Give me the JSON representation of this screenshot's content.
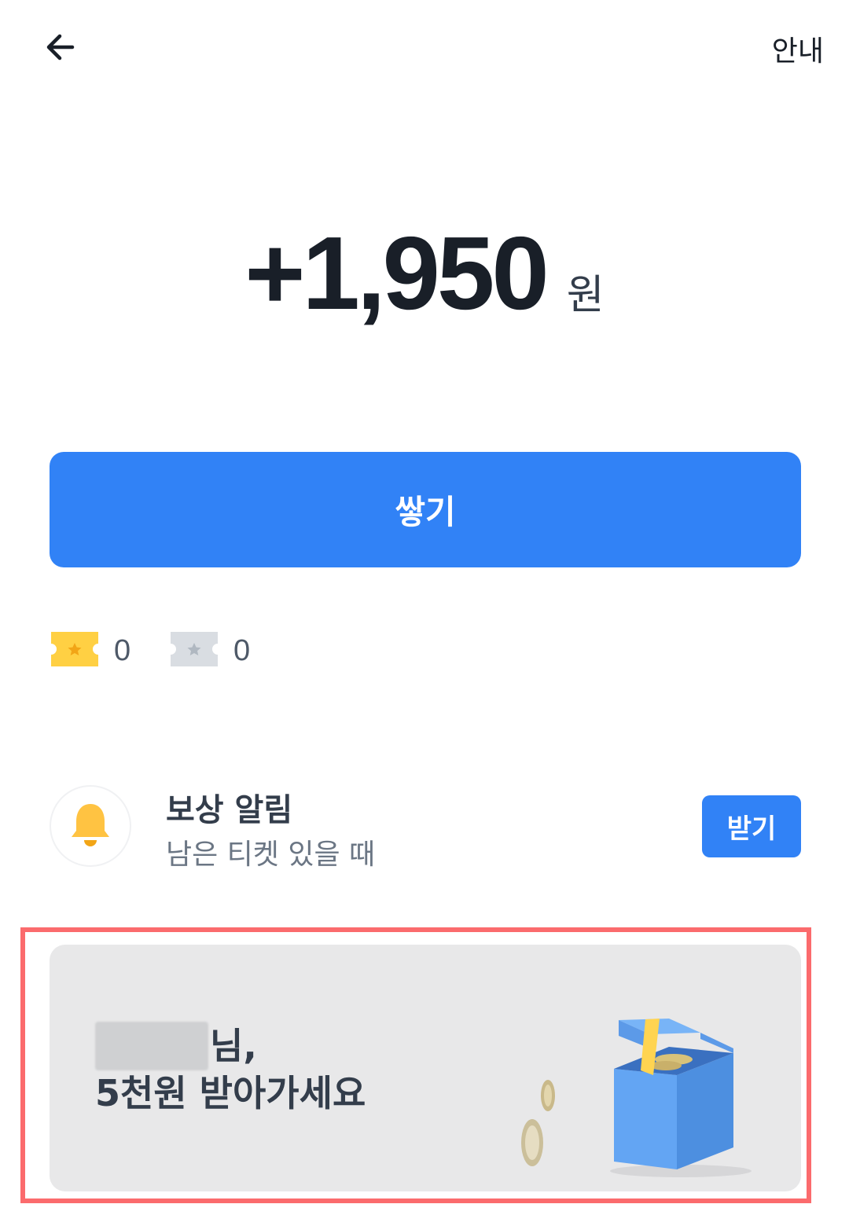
{
  "header": {
    "back_icon": "arrow-left-icon",
    "info_label": "안내"
  },
  "reward": {
    "amount": "+1,950",
    "unit": "원"
  },
  "primary_button": {
    "label": "쌓기"
  },
  "tickets": [
    {
      "type": "gold",
      "icon": "gold-ticket-icon",
      "count": "0",
      "color": "#ffd043"
    },
    {
      "type": "silver",
      "icon": "silver-ticket-icon",
      "count": "0",
      "color": "#d9dde2"
    }
  ],
  "alert": {
    "icon": "bell-icon",
    "title": "보상 알림",
    "subtitle": "남은 티켓 있을 때",
    "button_label": "받기"
  },
  "banner": {
    "name_suffix": "님,",
    "message": "5천원 받아가세요",
    "illustration": "gift-box-coins-icon"
  },
  "colors": {
    "accent": "#3182f6",
    "text_primary": "#191f28",
    "text_secondary": "#6b7684",
    "highlight": "#fb6b6d",
    "banner_bg": "#e8e8e9"
  }
}
